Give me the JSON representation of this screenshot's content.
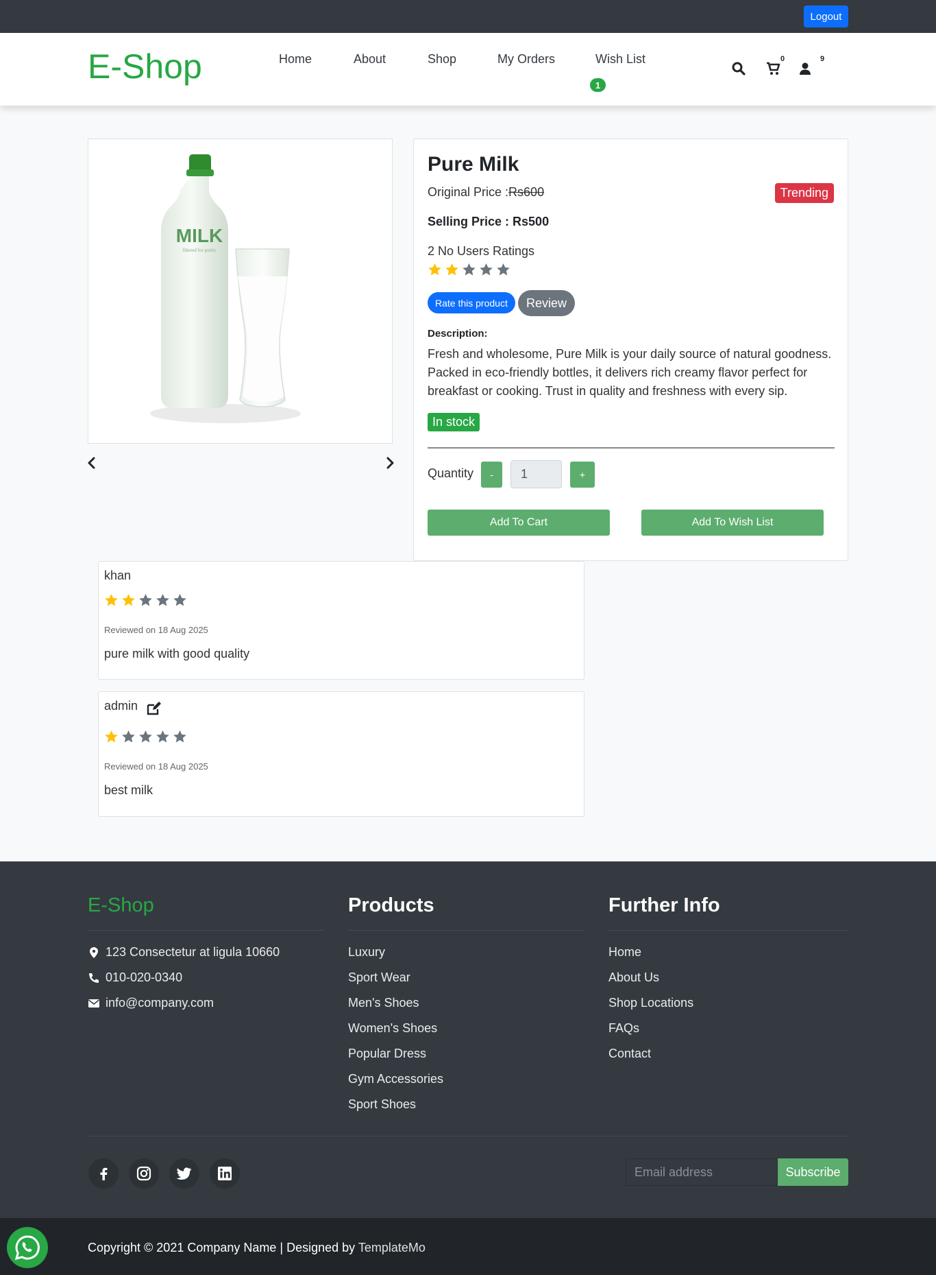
{
  "topbar": {
    "logout_label": "Logout"
  },
  "header": {
    "brand": "E-Shop",
    "nav": [
      "Home",
      "About",
      "Shop",
      "My Orders",
      "Wish List"
    ],
    "wishlist_badge": "1",
    "cart_count": "0",
    "user_count": "9",
    "icons": [
      "search-icon",
      "cart-icon",
      "user-icon"
    ]
  },
  "product": {
    "title": "Pure Milk",
    "original_price_label": "Original Price :",
    "original_price": "Rs600",
    "trending_label": "Trending",
    "selling_price": "Selling Price : Rs500",
    "ratings_count": "2 No Users Ratings",
    "rating": 2,
    "rating_max": 5,
    "rate_button": "Rate this product",
    "review_button": "Review",
    "description_label": "Description:",
    "description": "Fresh and wholesome, Pure Milk is your daily source of natural goodness. Packed in eco-friendly bottles, it delivers rich creamy flavor perfect for breakfast or cooking. Trust in quality and freshness with every sip.",
    "stock_label": "In stock",
    "quantity_label": "Quantity",
    "qty_minus": "-",
    "qty_plus": "+",
    "qty_value": "1",
    "add_to_cart": "Add To Cart",
    "add_to_wishlist": "Add To Wish List",
    "image_text": "MILK",
    "image_subtext": "filtered for purity"
  },
  "reviews": [
    {
      "name": "khan",
      "rating": 2,
      "date": "Reviewed on 18 Aug 2025",
      "text": "pure milk with good quality"
    },
    {
      "name": "admin",
      "rating": 1,
      "date": "Reviewed on 18 Aug 2025",
      "text": "best milk"
    }
  ],
  "footer": {
    "brand": "E-Shop",
    "contact": [
      "123 Consectetur at ligula 10660",
      "010-020-0340",
      "info@company.com"
    ],
    "products_heading": "Products",
    "products": [
      "Luxury",
      "Sport Wear",
      "Men's Shoes",
      "Women's Shoes",
      "Popular Dress",
      "Gym Accessories",
      "Sport Shoes"
    ],
    "info_heading": "Further Info",
    "info": [
      "Home",
      "About Us",
      "Shop Locations",
      "FAQs",
      "Contact"
    ],
    "social": [
      "facebook-icon",
      "instagram-icon",
      "twitter-icon",
      "linkedin-icon"
    ],
    "email_placeholder": "Email address",
    "subscribe": "Subscribe",
    "copyright": "Copyright © 2021 Company Name | Designed by ",
    "designer": "TemplateMo"
  },
  "colors": {
    "brand": "#28a745",
    "primary": "#0d6efd",
    "danger": "#dc3545",
    "star_on": "#ffc107",
    "star_off": "#6c757d",
    "dark": "#343a40"
  }
}
